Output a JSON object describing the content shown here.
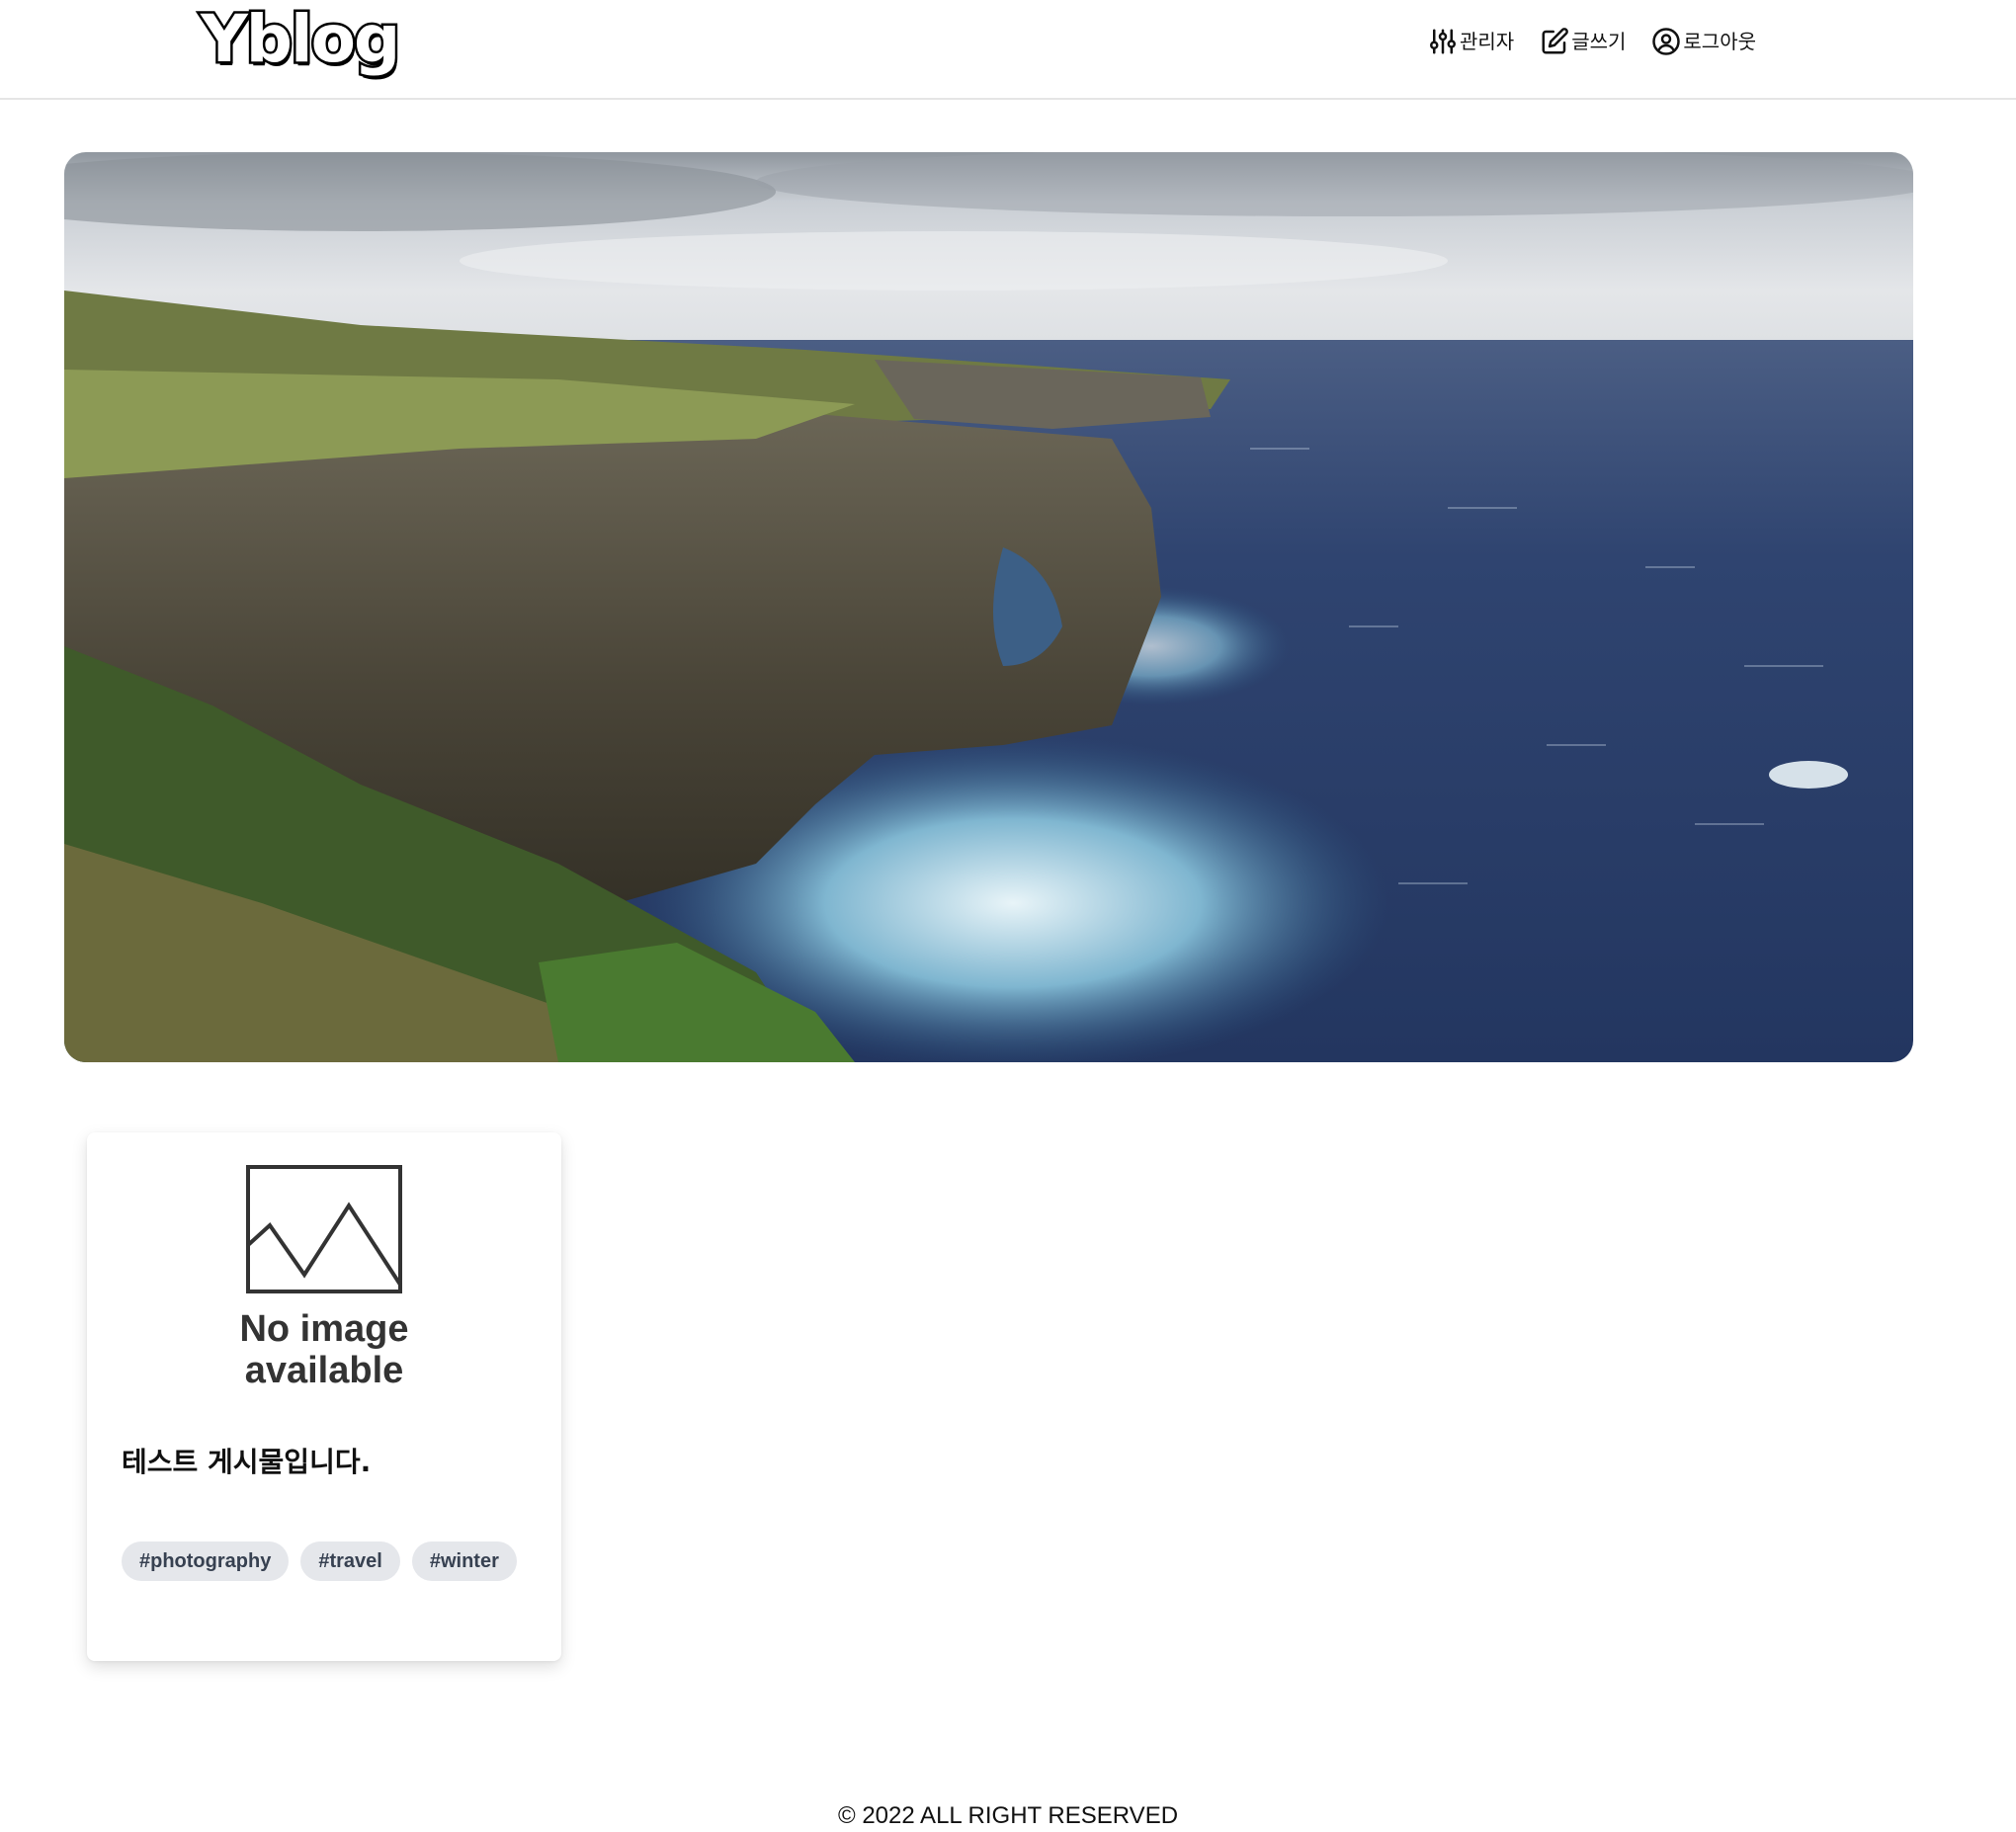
{
  "header": {
    "logo": "Yblog",
    "nav": [
      {
        "label": "관리자",
        "icon": "sliders-icon"
      },
      {
        "label": "글쓰기",
        "icon": "edit-icon"
      },
      {
        "label": "로그아웃",
        "icon": "user-circle-icon"
      }
    ]
  },
  "hero": {
    "image": "coastal-cliff-ocean-photo"
  },
  "posts": [
    {
      "thumbnail_text": [
        "No image",
        "available"
      ],
      "title": "테스트 게시물입니다.",
      "tags": [
        "#photography",
        "#travel",
        "#winter"
      ]
    }
  ],
  "footer": {
    "text": "© 2022 ALL RIGHT RESERVED"
  },
  "colors": {
    "tag_bg": "#e5e7eb",
    "tag_text": "#374151",
    "header_border": "#e5e5e5",
    "ocean": "#2a3e66",
    "sky": "#d9dde2"
  }
}
